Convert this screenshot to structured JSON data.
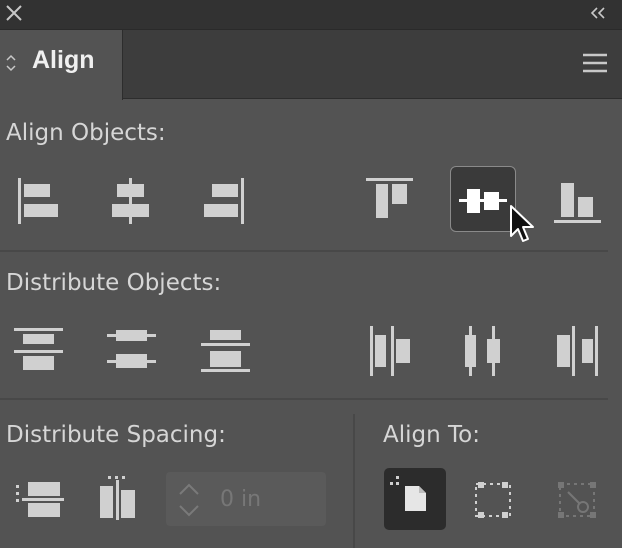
{
  "panel": {
    "tab_label": "Align",
    "sections": {
      "align_objects": "Align Objects:",
      "distribute_objects": "Distribute Objects:",
      "distribute_spacing": "Distribute Spacing:",
      "align_to": "Align To:"
    }
  },
  "spacing": {
    "value": "0 in"
  },
  "colors": {
    "panel_bg": "#535353",
    "icon": "#d0d0d0",
    "icon_dim": "#767676",
    "active_border": "#8a8a8a"
  }
}
